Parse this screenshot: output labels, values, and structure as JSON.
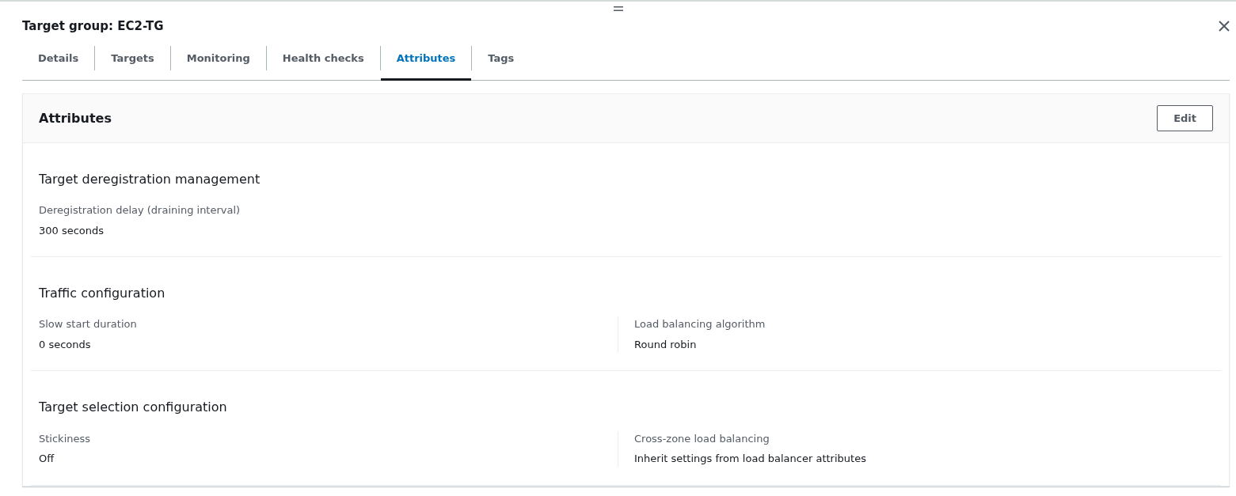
{
  "title": "Target group: EC2-TG",
  "tabs": [
    {
      "label": "Details",
      "selected": false
    },
    {
      "label": "Targets",
      "selected": false
    },
    {
      "label": "Monitoring",
      "selected": false
    },
    {
      "label": "Health checks",
      "selected": false
    },
    {
      "label": "Attributes",
      "selected": true
    },
    {
      "label": "Tags",
      "selected": false
    }
  ],
  "panel": {
    "title": "Attributes",
    "edit_button": "Edit",
    "sections": [
      {
        "title": "Target deregistration management",
        "fields": [
          {
            "label": "Deregistration delay (draining interval)",
            "value": "300 seconds"
          }
        ]
      },
      {
        "title": "Traffic configuration",
        "fields": [
          {
            "label": "Slow start duration",
            "value": "0 seconds"
          },
          {
            "label": "Load balancing algorithm",
            "value": "Round robin"
          }
        ]
      },
      {
        "title": "Target selection configuration",
        "fields": [
          {
            "label": "Stickiness",
            "value": "Off"
          },
          {
            "label": "Cross-zone load balancing",
            "value": "Inherit settings from load balancer attributes"
          }
        ]
      }
    ]
  }
}
